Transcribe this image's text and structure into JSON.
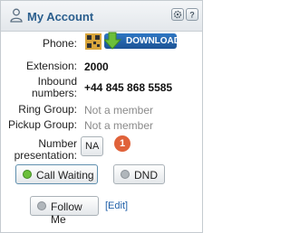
{
  "header": {
    "title": "My Account",
    "gear_icon": "gear-icon",
    "help_icon": "help-icon"
  },
  "fields": {
    "phone_label": "Phone:",
    "download_label": "DOWNLOAD",
    "extension_label": "Extension:",
    "extension_value": "2000",
    "inbound_label_line1": "Inbound",
    "inbound_label_line2": "numbers:",
    "inbound_value": "+44 845 868 5585",
    "ring_label": "Ring Group:",
    "ring_value": "Not a member",
    "pickup_label": "Pickup Group:",
    "pickup_value": "Not a member",
    "presentation_label_line1": "Number",
    "presentation_label_line2": "presentation:",
    "presentation_value": "NA",
    "badge_count": "1"
  },
  "buttons": {
    "call_waiting": "Call Waiting",
    "dnd": "DND",
    "follow_me": "Follow Me",
    "edit": "[Edit]"
  },
  "colors": {
    "accent": "#2b5f8e",
    "active": "#6bbf3a",
    "inactive": "#9aa0a6",
    "badge": "#e0623a"
  }
}
